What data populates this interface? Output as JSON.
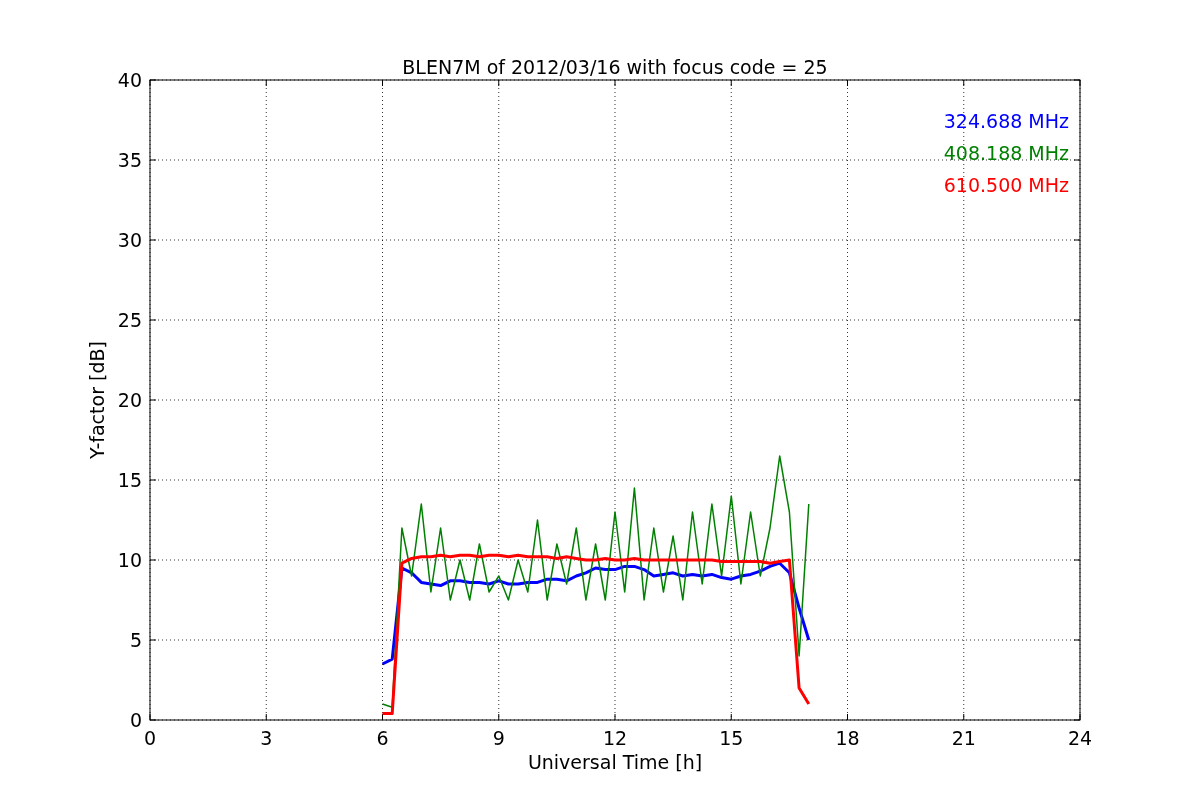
{
  "figure": {
    "chart_data": {
      "type": "line",
      "title": "BLEN7M of 2012/03/16 with focus code = 25",
      "xlabel": "Universal Time [h]",
      "ylabel": "Y-factor [dB]",
      "x": [
        6,
        6.25,
        6.5,
        6.75,
        7,
        7.25,
        7.5,
        7.75,
        8,
        8.25,
        8.5,
        8.75,
        9,
        9.25,
        9.5,
        9.75,
        10,
        10.25,
        10.5,
        10.75,
        11,
        11.25,
        11.5,
        11.75,
        12,
        12.25,
        12.5,
        12.75,
        13,
        13.25,
        13.5,
        13.75,
        14,
        14.25,
        14.5,
        14.75,
        15,
        15.25,
        15.5,
        15.75,
        16,
        16.25,
        16.5,
        16.75,
        17
      ],
      "grid": true,
      "xlim": [
        0,
        24
      ],
      "ylim": [
        0,
        40
      ],
      "xticks": [
        0,
        3,
        6,
        9,
        12,
        15,
        18,
        21,
        24
      ],
      "yticks": [
        0,
        5,
        10,
        15,
        20,
        25,
        30,
        35,
        40
      ],
      "series": [
        {
          "name": "324.688 MHz",
          "color": "#0000ff",
          "values": [
            3.5,
            3.8,
            9.5,
            9.2,
            8.6,
            8.5,
            8.4,
            8.7,
            8.7,
            8.6,
            8.6,
            8.5,
            8.7,
            8.5,
            8.5,
            8.6,
            8.6,
            8.8,
            8.8,
            8.7,
            9.0,
            9.2,
            9.5,
            9.4,
            9.4,
            9.6,
            9.6,
            9.4,
            9.0,
            9.1,
            9.2,
            9.0,
            9.1,
            9.0,
            9.1,
            8.9,
            8.8,
            9.0,
            9.1,
            9.3,
            9.6,
            9.8,
            9.2,
            7.0,
            5.0
          ]
        },
        {
          "name": "408.188 MHz",
          "color": "#008000",
          "values": [
            1.0,
            0.8,
            12,
            9,
            13.5,
            8,
            12,
            7.5,
            10,
            7.5,
            11,
            8,
            9,
            7.5,
            10,
            8,
            12.5,
            7.5,
            11,
            8.5,
            12,
            7.5,
            11,
            7.5,
            13,
            8,
            14.5,
            7.5,
            12,
            8,
            11.5,
            7.5,
            13,
            8.5,
            13.5,
            9,
            14,
            8.5,
            13,
            9,
            12,
            16.5,
            13,
            4,
            13.5
          ]
        },
        {
          "name": "610.500 MHz",
          "color": "#ff0000",
          "values": [
            0.4,
            0.4,
            9.8,
            10.1,
            10.2,
            10.2,
            10.3,
            10.2,
            10.3,
            10.3,
            10.2,
            10.3,
            10.3,
            10.2,
            10.3,
            10.2,
            10.2,
            10.2,
            10.1,
            10.2,
            10.1,
            10.0,
            10.0,
            10.1,
            10.0,
            10.0,
            10.1,
            10.0,
            10.0,
            10.0,
            10.0,
            10.0,
            10.0,
            10.0,
            10.0,
            9.9,
            9.9,
            9.9,
            9.9,
            9.9,
            9.8,
            9.9,
            10.0,
            2.0,
            1.0
          ]
        }
      ]
    }
  }
}
